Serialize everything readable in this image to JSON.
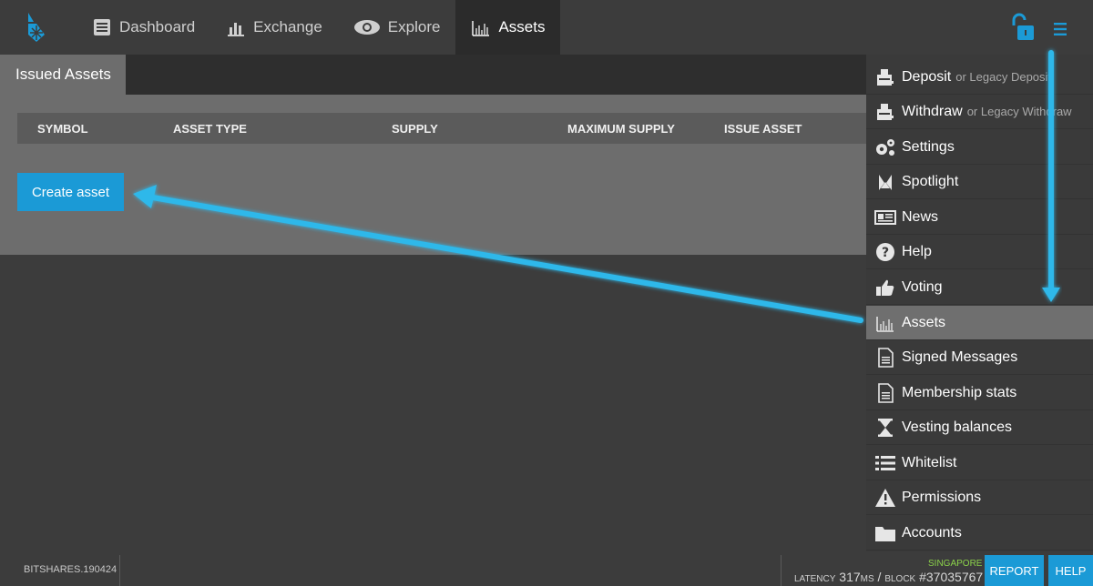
{
  "header": {
    "nav": [
      {
        "label": "Dashboard",
        "icon": "dashboard-icon"
      },
      {
        "label": "Exchange",
        "icon": "bar-chart-icon"
      },
      {
        "label": "Explore",
        "icon": "eye-icon"
      },
      {
        "label": "Assets",
        "icon": "assets-icon",
        "active": true
      }
    ]
  },
  "issued": {
    "tab_label": "Issued Assets",
    "columns": [
      "SYMBOL",
      "ASSET TYPE",
      "SUPPLY",
      "MAXIMUM SUPPLY",
      "ISSUE ASSET"
    ],
    "create_label": "Create asset"
  },
  "menu": {
    "items": [
      {
        "label": "Deposit",
        "sub": "or Legacy Deposit",
        "icon": "deposit-icon"
      },
      {
        "label": "Withdraw",
        "sub": "or Legacy Withdraw",
        "icon": "withdraw-icon"
      },
      {
        "label": "Settings",
        "icon": "gears-icon"
      },
      {
        "label": "Spotlight",
        "icon": "spotlight-icon"
      },
      {
        "label": "News",
        "icon": "news-icon"
      },
      {
        "label": "Help",
        "icon": "help-icon"
      },
      {
        "label": "Voting",
        "icon": "thumbs-up-icon"
      },
      {
        "label": "Assets",
        "icon": "assets-icon",
        "active": true
      },
      {
        "label": "Signed Messages",
        "icon": "document-icon"
      },
      {
        "label": "Membership stats",
        "icon": "document-icon"
      },
      {
        "label": "Vesting balances",
        "icon": "hourglass-icon"
      },
      {
        "label": "Whitelist",
        "icon": "list-icon"
      },
      {
        "label": "Permissions",
        "icon": "warning-icon"
      },
      {
        "label": "Accounts",
        "icon": "folder-icon"
      }
    ]
  },
  "footer": {
    "version": "BITSHARES.190424",
    "node_location": "SINGAPORE",
    "latency_label": "LATENCY",
    "latency_value": "317",
    "latency_unit": "MS",
    "block_label": "BLOCK",
    "block_value": "#37035767",
    "report_label": "REPORT",
    "help_label": "HELP"
  },
  "colors": {
    "accent": "#1b9ad6",
    "background": "#3c3c3c",
    "panel": "#6d6d6d",
    "node_green": "#8bd14a"
  }
}
